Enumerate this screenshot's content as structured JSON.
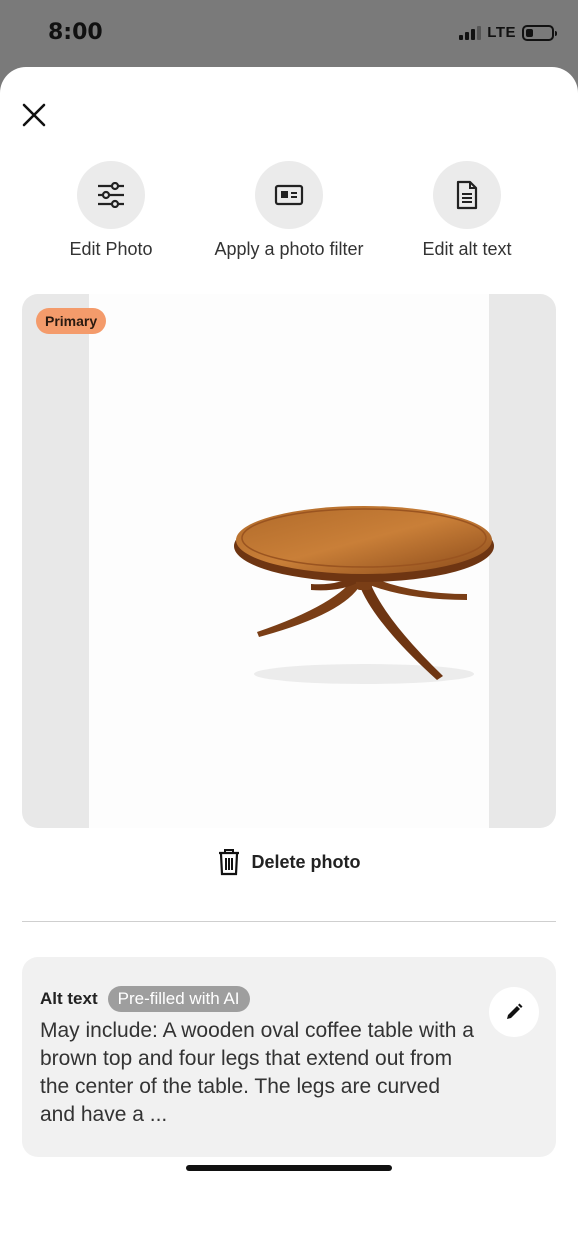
{
  "status_bar": {
    "time": "8:00",
    "network": "LTE",
    "battery_level": 0.3
  },
  "sheet": {
    "close_icon": "close-icon",
    "actions": [
      {
        "label": "Edit Photo",
        "icon": "sliders-icon"
      },
      {
        "label": "Apply a photo filter",
        "icon": "filter-icon"
      },
      {
        "label": "Edit alt text",
        "icon": "document-icon"
      }
    ],
    "photo": {
      "badge": "Primary",
      "badge_color": "#f49b6b"
    },
    "delete": {
      "label": "Delete photo",
      "icon": "trash-icon"
    },
    "alt_text": {
      "title": "Alt text",
      "badge": "Pre-filled with AI",
      "body": "May include: A wooden oval coffee table with a brown top and four legs that extend out from the center of the table. The legs are curved and have a ...",
      "edit_icon": "pencil-icon"
    }
  }
}
